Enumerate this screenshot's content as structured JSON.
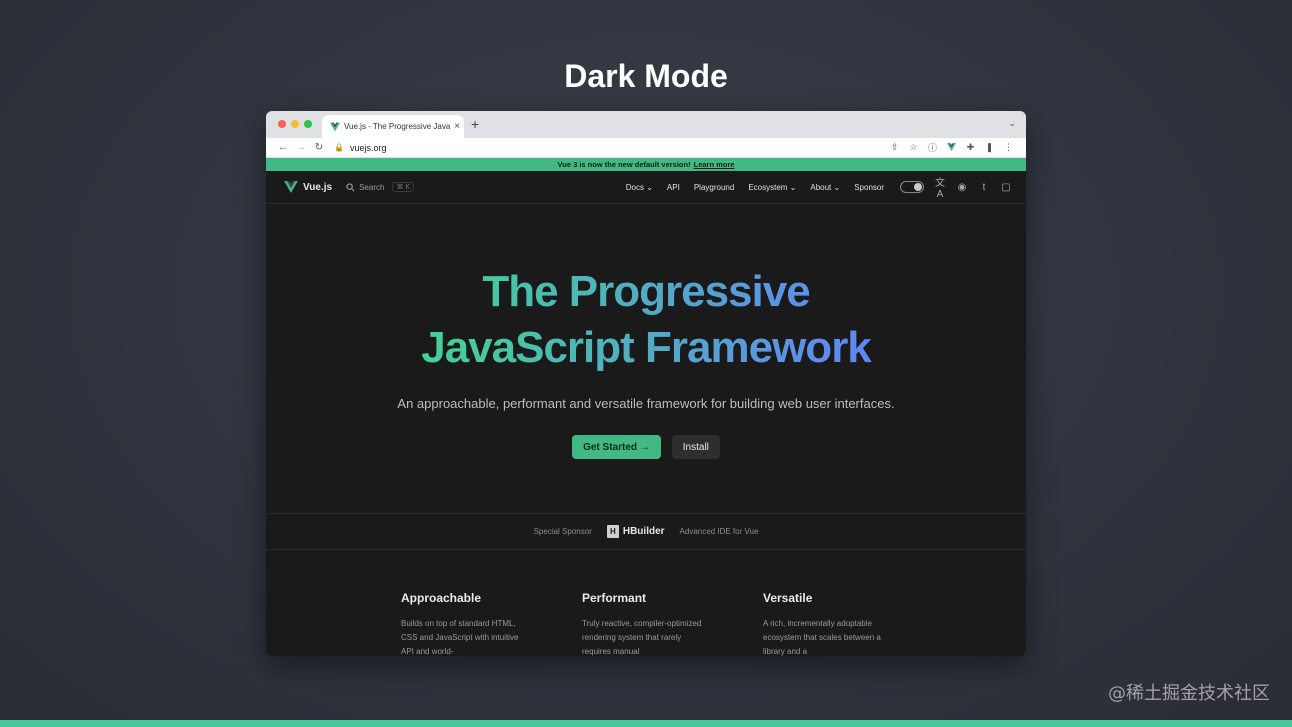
{
  "slide": {
    "title": "Dark Mode",
    "watermark": "@稀土掘金技术社区"
  },
  "browser": {
    "tab_title": "Vue.js - The Progressive JavaS",
    "tab_close": "×",
    "new_tab": "+",
    "tab_menu": "⌄",
    "back": "←",
    "forward": "→",
    "reload": "↻",
    "lock": "🔒",
    "url": "vuejs.org",
    "extensions": [
      "⇪",
      "☆",
      "ⓘ",
      "✚",
      "❚",
      "⋮"
    ]
  },
  "banner": {
    "text": "Vue 3 is now the new default version!",
    "link": "Learn more"
  },
  "site_nav": {
    "logo_text": "Vue.js",
    "search_label": "Search",
    "search_kbd": "⌘ K",
    "items": [
      {
        "label": "Docs ⌄"
      },
      {
        "label": "API"
      },
      {
        "label": "Playground"
      },
      {
        "label": "Ecosystem ⌄"
      },
      {
        "label": "About ⌄"
      },
      {
        "label": "Sponsor"
      }
    ],
    "social": [
      "文A",
      "◉",
      "t",
      "▢"
    ]
  },
  "hero": {
    "title_line1": "The Progressive",
    "title_line2": "JavaScript Framework",
    "subtitle": "An approachable, performant and versatile framework for building web user interfaces.",
    "primary_button": "Get Started →",
    "secondary_button": "Install"
  },
  "sponsor": {
    "label": "Special Sponsor",
    "brand": "HBuilder",
    "brand_icon": "H",
    "tagline": "Advanced IDE for Vue"
  },
  "features": [
    {
      "title": "Approachable",
      "text": "Builds on top of standard HTML, CSS and JavaScript with intuitive API and world-"
    },
    {
      "title": "Performant",
      "text": "Truly reactive, compiler-optimized rendering system that rarely requires manual"
    },
    {
      "title": "Versatile",
      "text": "A rich, incrementally adoptable ecosystem that scales between a library and a"
    }
  ],
  "colors": {
    "accent": "#42b883",
    "gradient_start": "#42d392",
    "gradient_end": "#647eff",
    "page_bg": "#1a1a1a"
  }
}
